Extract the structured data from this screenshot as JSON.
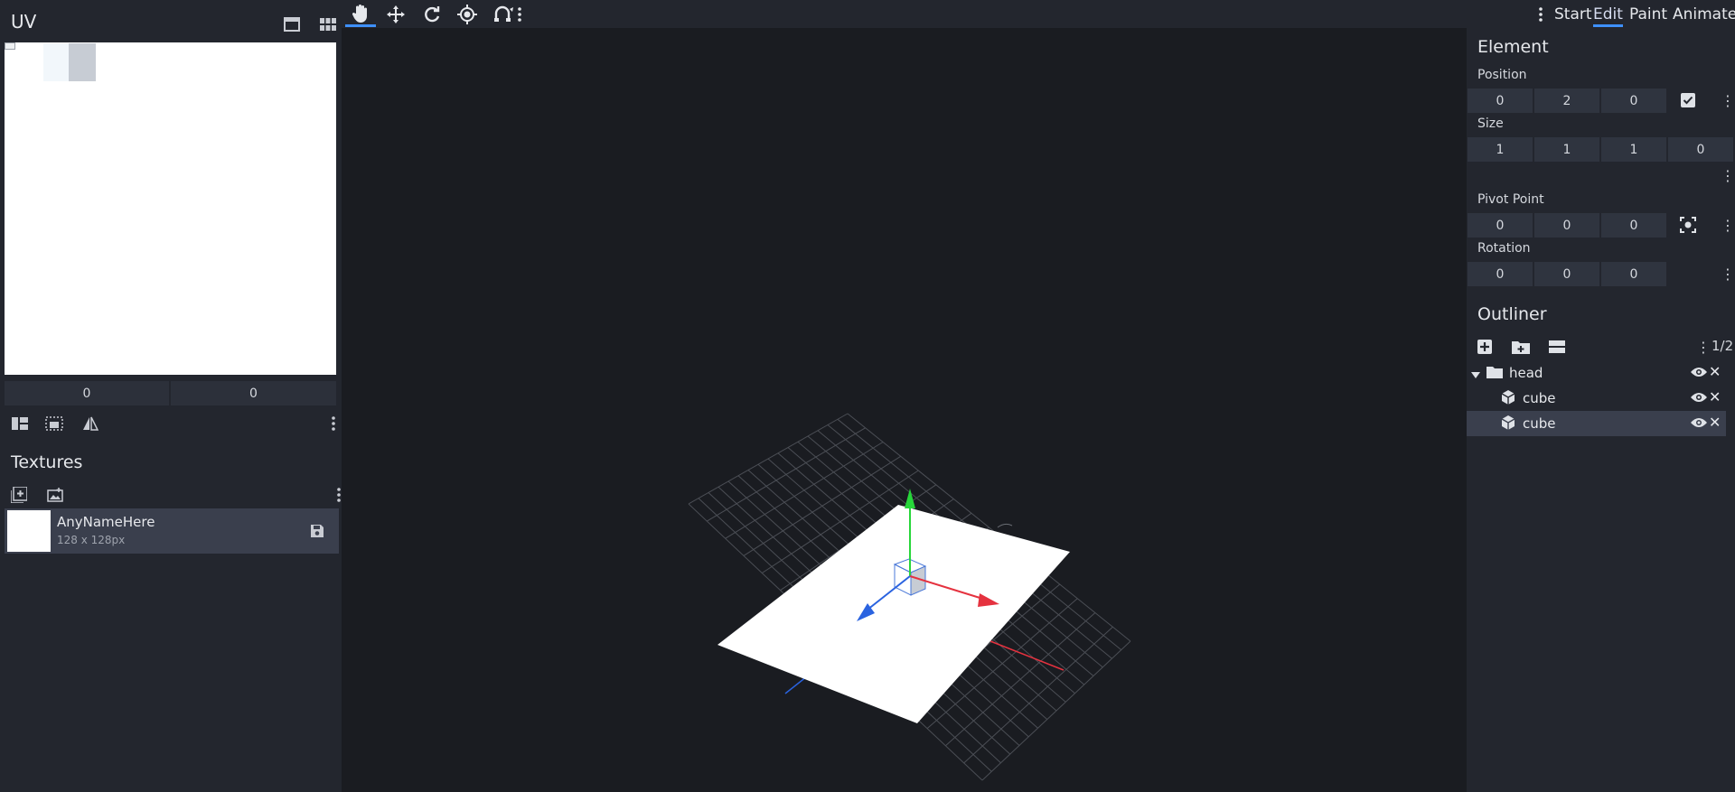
{
  "uv_panel": {
    "title": "UV",
    "coord_x": "0",
    "coord_y": "0"
  },
  "textures": {
    "title": "Textures",
    "items": [
      {
        "name": "AnyNameHere",
        "size": "128 x 128px"
      }
    ]
  },
  "toolbar": {
    "tools": [
      "hand-icon",
      "move-icon",
      "rotate-icon",
      "pivot-icon",
      "vertex-snap-icon"
    ],
    "active_tool": "hand-icon",
    "modes": [
      "Start",
      "Edit",
      "Paint",
      "Animate"
    ],
    "active_mode": "Edit"
  },
  "element": {
    "title": "Element",
    "position_label": "Position",
    "position": [
      "0",
      "2",
      "0"
    ],
    "size_label": "Size",
    "size": [
      "1",
      "1",
      "1",
      "0"
    ],
    "pivot_label": "Pivot Point",
    "pivot": [
      "0",
      "0",
      "0"
    ],
    "rotation_label": "Rotation",
    "rotation": [
      "0",
      "0",
      "0"
    ]
  },
  "outliner": {
    "title": "Outliner",
    "count": "1/2",
    "items": [
      {
        "name": "head",
        "type": "group"
      },
      {
        "name": "cube",
        "type": "cube"
      },
      {
        "name": "cube",
        "type": "cube",
        "selected": true
      }
    ]
  },
  "colors": {
    "accent": "#3e90ff",
    "axis_x": "#e5323f",
    "axis_y": "#27d63a",
    "axis_z": "#2a63e0"
  }
}
